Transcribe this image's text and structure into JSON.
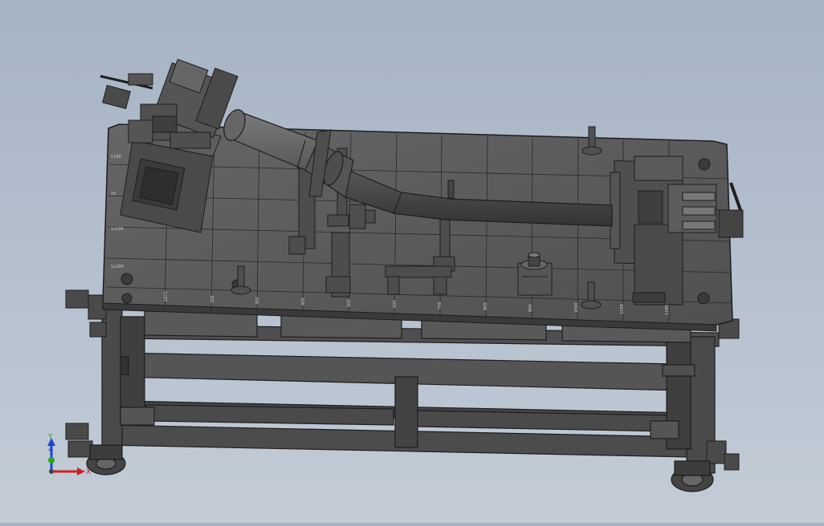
{
  "viewport": {
    "background_top": "#a6b3c4",
    "background_bottom": "#c3ccd6",
    "model_color": "#5a5a5a",
    "edge_color": "#1e1e1e"
  },
  "triad": {
    "x_label": "X",
    "y_label": "Y",
    "z_label": "Z",
    "x_color": "#cc2222",
    "y_color": "#22aa22",
    "z_color": "#2244cc"
  },
  "plate_marks": {
    "left": [
      "1700",
      "10",
      "1x100",
      "1x200"
    ],
    "bottom": [
      "1073",
      "200",
      "300",
      "400",
      "500",
      "600",
      "700",
      "800",
      "900",
      "1000",
      "1100",
      "1200",
      "1300",
      "1400",
      "1500",
      "1600"
    ]
  }
}
